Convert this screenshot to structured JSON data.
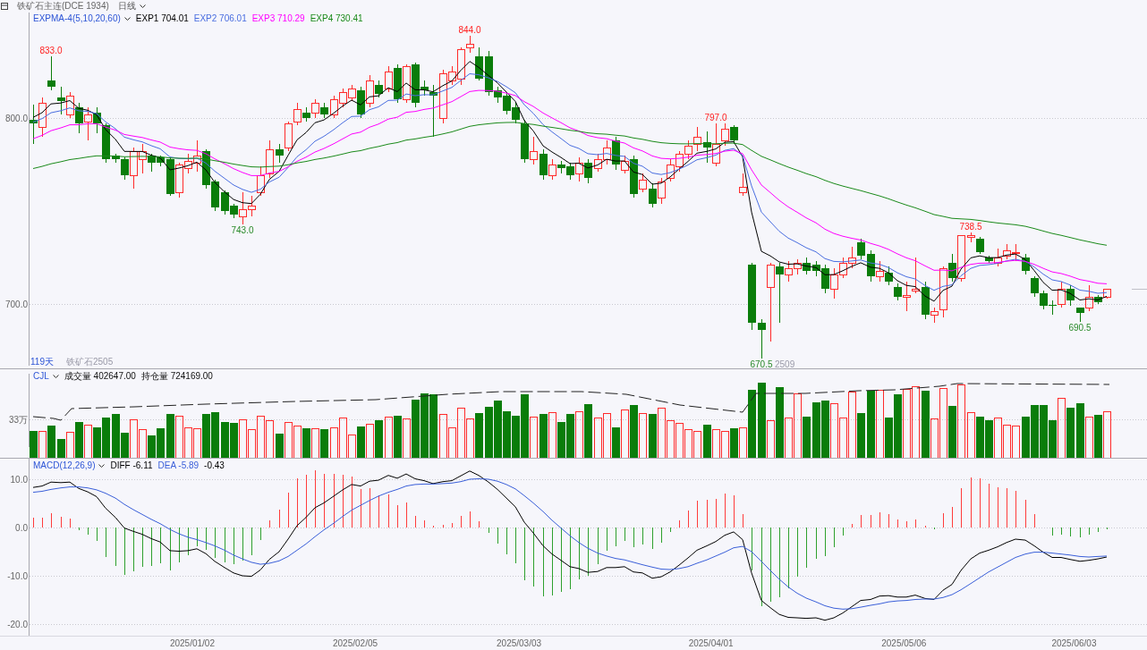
{
  "window": {
    "title": "铁矿石主连(DCE 1934)",
    "period": "日线"
  },
  "price_panel": {
    "indicator": "EXPMA-4(5,10,20,60)",
    "values": [
      {
        "label": "EXP1 704.01",
        "color": "#000000"
      },
      {
        "label": "EXP2 706.01",
        "color": "#4a6ee0"
      },
      {
        "label": "EXP3 710.29",
        "color": "#ff00ff"
      },
      {
        "label": "EXP4 730.41",
        "color": "#1a8a1a"
      }
    ],
    "axis_labels": [
      "800.0",
      "700.0"
    ],
    "price_marks": [
      {
        "text": "833.0",
        "kind": "high"
      },
      {
        "text": "743.0",
        "kind": "low"
      },
      {
        "text": "844.0",
        "kind": "high"
      },
      {
        "text": "797.0",
        "kind": "high"
      },
      {
        "text": "670.5",
        "kind": "low"
      },
      {
        "text": "738.5",
        "kind": "high"
      },
      {
        "text": "690.5",
        "kind": "low"
      }
    ],
    "contract_marker": "2509",
    "day_count": "119天",
    "contract": "铁矿石2505"
  },
  "volume_panel": {
    "indicator": "CJL",
    "readings": [
      "成交量 402647.00",
      "持仓量 724169.00"
    ],
    "axis_label": "33万"
  },
  "macd_panel": {
    "indicator": "MACD(12,26,9)",
    "values": [
      {
        "label": "DIFF -6.11",
        "color": "#000000"
      },
      {
        "label": "DEA -5.89",
        "color": "#3a5fd9"
      },
      {
        "label": "-0.43",
        "color": "#000000"
      }
    ],
    "chart_data": {
      "type": "line",
      "grid": true,
      "ylim": [
        -22.4,
        14.26
      ],
      "yticks": [
        {
          "value": 10,
          "label": "10.0"
        },
        {
          "value": 0,
          "label": "0.0"
        },
        {
          "value": -10,
          "label": "-10.0"
        },
        {
          "value": -20,
          "label": "-20.0"
        }
      ],
      "series": [
        {
          "type": "line",
          "color": "#000000",
          "values": [
            8.3,
            8.6,
            9.4,
            9.3,
            9.4,
            8.1,
            7.4,
            6.4,
            4.0,
            2.1,
            -0.1,
            -0.8,
            -1.4,
            -2.3,
            -3.0,
            -4.8,
            -4.9,
            -4.8,
            -4.4,
            -5.4,
            -7.0,
            -8.3,
            -9.4,
            -10.0,
            -10.1,
            -8.8,
            -6.6,
            -5.0,
            -2.4,
            0.4,
            2.1,
            4.1,
            5.1,
            6.5,
            7.8,
            8.9,
            8.6,
            9.6,
            9.8,
            10.8,
            10.2,
            11.1,
            10.1,
            9.7,
            9.1,
            9.5,
            9.7,
            10.7,
            11.7,
            10.8,
            9.4,
            7.9,
            6.1,
            4.3,
            1.1,
            -1.1,
            -3.8,
            -5.5,
            -6.8,
            -8.1,
            -8.5,
            -9.3,
            -9.1,
            -8.3,
            -8.3,
            -8.1,
            -9.2,
            -9.4,
            -10.5,
            -10.2,
            -9.2,
            -7.8,
            -6.3,
            -4.7,
            -3.8,
            -2.9,
            -1.6,
            -0.9,
            -2.5,
            -9.4,
            -15.1,
            -16.6,
            -18.0,
            -18.6,
            -18.7,
            -18.8,
            -18.7,
            -19.2,
            -18.7,
            -17.7,
            -16.4,
            -15.1,
            -14.9,
            -14.2,
            -14.1,
            -14.4,
            -14.4,
            -14.0,
            -14.7,
            -14.9,
            -13.0,
            -11.8,
            -8.9,
            -6.5,
            -5.3,
            -4.7,
            -4.0,
            -3.1,
            -2.4,
            -2.6,
            -3.8,
            -5.1,
            -6.2,
            -6.2,
            -6.6,
            -7.0,
            -6.8,
            -6.5,
            -6.1
          ]
        },
        {
          "type": "line",
          "color": "#3a5fd9",
          "values": [
            7.3,
            7.5,
            7.9,
            8.2,
            8.4,
            8.4,
            8.2,
            7.8,
            7.1,
            6.1,
            4.8,
            3.7,
            2.7,
            1.7,
            0.8,
            -0.4,
            -1.3,
            -2.0,
            -2.5,
            -3.1,
            -3.8,
            -4.7,
            -5.7,
            -6.5,
            -7.2,
            -7.6,
            -7.4,
            -6.9,
            -6.0,
            -4.7,
            -3.4,
            -1.9,
            -0.5,
            0.9,
            2.3,
            3.6,
            4.6,
            5.6,
            6.5,
            7.3,
            7.9,
            8.6,
            8.9,
            9.0,
            9.0,
            9.1,
            9.2,
            9.5,
            10.0,
            10.1,
            10.0,
            9.6,
            8.9,
            8.0,
            6.6,
            5.1,
            3.3,
            1.5,
            -0.1,
            -1.7,
            -3.1,
            -4.3,
            -5.3,
            -5.9,
            -6.4,
            -6.7,
            -7.2,
            -7.7,
            -8.2,
            -8.6,
            -8.7,
            -8.5,
            -8.1,
            -7.4,
            -6.7,
            -5.9,
            -5.1,
            -4.2,
            -3.9,
            -5.0,
            -7.0,
            -8.9,
            -10.7,
            -12.3,
            -13.6,
            -14.6,
            -15.4,
            -16.2,
            -16.7,
            -16.9,
            -16.8,
            -16.5,
            -16.1,
            -15.8,
            -15.4,
            -15.2,
            -15.1,
            -14.9,
            -14.8,
            -14.8,
            -14.5,
            -13.9,
            -12.9,
            -11.6,
            -10.4,
            -9.2,
            -8.2,
            -7.2,
            -6.2,
            -5.5,
            -5.1,
            -5.1,
            -5.3,
            -5.5,
            -5.7,
            -6.0,
            -6.1,
            -6.0,
            -5.9
          ]
        },
        {
          "type": "bar",
          "color": "#ff3b3b",
          "values": [
            2.1,
            2.1,
            3.0,
            2.3,
            1.9,
            null,
            null,
            null,
            null,
            null,
            null,
            null,
            null,
            null,
            null,
            null,
            null,
            null,
            null,
            null,
            null,
            null,
            null,
            null,
            null,
            null,
            1.5,
            3.7,
            7.2,
            10.2,
            10.9,
            11.9,
            11.2,
            11.1,
            11.0,
            10.6,
            7.9,
            8.1,
            6.7,
            6.9,
            4.7,
            5.1,
            2.5,
            1.4,
            0.1,
            0.6,
            0.9,
            2.4,
            3.4,
            1.3,
            null,
            null,
            null,
            null,
            null,
            null,
            null,
            null,
            null,
            null,
            null,
            null,
            null,
            null,
            null,
            null,
            null,
            null,
            null,
            null,
            null,
            1.5,
            3.6,
            5.5,
            5.8,
            6.0,
            7.0,
            6.6,
            2.8,
            null,
            null,
            null,
            null,
            null,
            null,
            null,
            null,
            null,
            null,
            null,
            0.8,
            2.6,
            2.6,
            3.1,
            2.7,
            1.6,
            1.3,
            1.6,
            0.3,
            null,
            2.9,
            4.3,
            8.1,
            10.3,
            10.2,
            9.1,
            8.4,
            8.2,
            7.6,
            5.7,
            2.8,
            null,
            null,
            null,
            null,
            null,
            null,
            null,
            null
          ]
        },
        {
          "type": "bar",
          "color": "#2ea02e",
          "values": [
            null,
            null,
            null,
            null,
            null,
            -0.5,
            -1.5,
            -2.8,
            -6.1,
            -7.9,
            -9.9,
            -9.1,
            -8.2,
            -8.0,
            -7.4,
            -8.9,
            -7.3,
            -5.7,
            -3.9,
            -4.6,
            -6.3,
            -7.2,
            -7.5,
            -6.9,
            -5.7,
            -2.5,
            null,
            null,
            null,
            null,
            null,
            null,
            null,
            null,
            null,
            null,
            null,
            null,
            null,
            null,
            null,
            null,
            null,
            null,
            null,
            null,
            null,
            null,
            null,
            null,
            -1.2,
            -3.3,
            -5.5,
            -7.4,
            -11.0,
            -12.3,
            -14.2,
            -14.0,
            -13.4,
            -12.8,
            -10.8,
            -10.0,
            -7.6,
            -4.8,
            -3.9,
            -2.7,
            -4.0,
            -3.5,
            -4.5,
            -3.2,
            -0.9,
            null,
            null,
            null,
            null,
            null,
            null,
            null,
            null,
            -8.9,
            -16.2,
            -15.3,
            -14.5,
            -12.6,
            -10.1,
            -8.3,
            -6.5,
            -6.0,
            -4.1,
            -1.6,
            null,
            null,
            null,
            null,
            null,
            null,
            null,
            null,
            null,
            -0.1,
            null,
            null,
            null,
            null,
            null,
            null,
            null,
            null,
            null,
            null,
            null,
            null,
            -1.7,
            -1.4,
            -1.8,
            -2.0,
            -1.4,
            -1.0,
            -0.4
          ]
        }
      ]
    }
  },
  "date_axis": [
    "2025/01/02",
    "2025/02/05",
    "2025/03/03",
    "2025/04/01",
    "2025/05/06",
    "2025/06/03"
  ]
}
